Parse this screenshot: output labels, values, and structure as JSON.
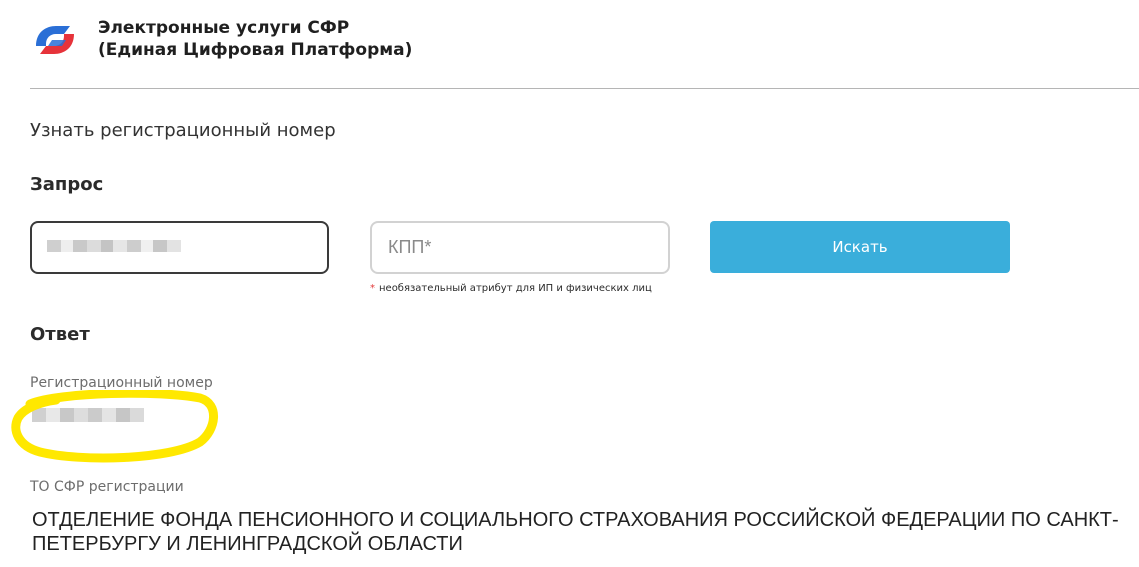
{
  "header": {
    "logo_icon": "sfr-logo-icon",
    "title_line1": "Электронные услуги СФР",
    "title_line2": "(Единая Цифровая Платформа)"
  },
  "page": {
    "title": "Узнать регистрационный номер"
  },
  "request": {
    "section_title": "Запрос",
    "inn_value": "",
    "inn_value_obscured": true,
    "kpp_placeholder": "КПП*",
    "kpp_value": "",
    "search_label": "Искать",
    "hint_star": "*",
    "hint_text": "необязательный атрибут для ИП и физических лиц"
  },
  "answer": {
    "section_title": "Ответ",
    "reg_number_label": "Регистрационный номер",
    "reg_number_value": "",
    "reg_number_obscured": true,
    "to_label": "ТО СФР регистрации",
    "to_value": "ОТДЕЛЕНИЕ ФОНДА ПЕНСИОННОГО И СОЦИАЛЬНОГО СТРАХОВАНИЯ РОССИЙСКОЙ ФЕДЕРАЦИИ ПО САНКТ-ПЕТЕРБУРГУ И ЛЕНИНГРАДСКОЙ ОБЛАСТИ"
  },
  "colors": {
    "accent_button": "#3aaedb",
    "logo_blue": "#2a6fd6",
    "logo_red": "#e6333a",
    "highlight_yellow": "#ffe800",
    "hint_star": "#e23b3b"
  }
}
